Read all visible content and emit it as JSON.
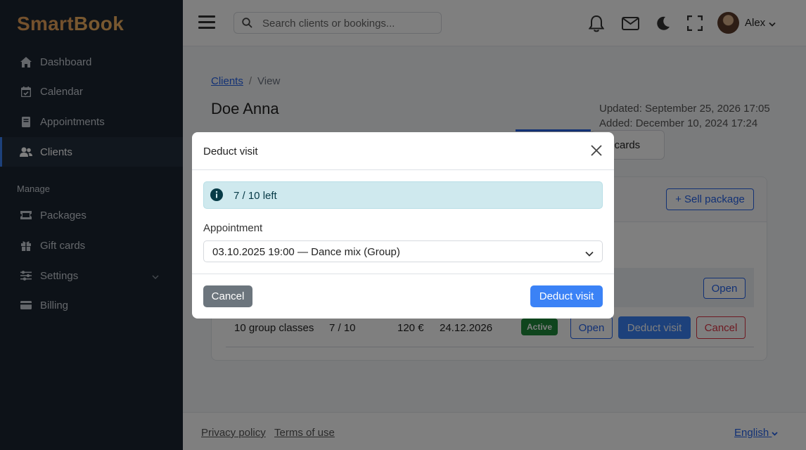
{
  "app": {
    "logo_part1": "Smart",
    "logo_part2": "Book"
  },
  "sidebar": {
    "items": [
      {
        "label": "Dashboard",
        "icon": "home-icon"
      },
      {
        "label": "Calendar",
        "icon": "calendar-check-icon"
      },
      {
        "label": "Appointments",
        "icon": "book-icon"
      },
      {
        "label": "Clients",
        "icon": "users-icon",
        "active": true
      }
    ],
    "section_label": "Manage",
    "manage_items": [
      {
        "label": "Packages",
        "icon": "ticket-icon"
      },
      {
        "label": "Gift cards",
        "icon": "gift-icon"
      },
      {
        "label": "Settings",
        "icon": "sliders-icon"
      },
      {
        "label": "Billing",
        "icon": "credit-card-icon"
      }
    ]
  },
  "header": {
    "search_placeholder": "Search clients or bookings...",
    "user_name": "Alex"
  },
  "breadcrumb": {
    "link": "Clients",
    "separator": "/",
    "current": "View"
  },
  "client": {
    "name": "Doe Anna",
    "updated": "Updated: September 25, 2026 17:05",
    "added": "Added: December 10, 2024 17:24"
  },
  "tabs": {
    "gift_cards_partial": "ft cards"
  },
  "packages_card": {
    "sell_label": "+ Sell package",
    "open_label": "Open",
    "row": {
      "name": "10 group classes",
      "visits": "7 / 10",
      "price": "120 €",
      "expires": "24.12.2026",
      "status": "Active",
      "open_label": "Open",
      "deduct_label": "Deduct visit",
      "cancel_label": "Cancel"
    }
  },
  "footer": {
    "privacy": "Privacy policy",
    "terms": "Terms of use",
    "language": "English"
  },
  "modal": {
    "title": "Deduct visit",
    "info_text": "7 / 10 left",
    "appointment_label": "Appointment",
    "appointment_value": "03.10.2025 19:00 — Dance mix (Group)",
    "cancel_label": "Cancel",
    "deduct_label": "Deduct visit"
  },
  "colors": {
    "sidebar_bg": "#1b2430",
    "accent": "#3b82f6",
    "active_badge": "#1f8a3b",
    "info_bg": "#cfe9ee",
    "danger": "#dc3545"
  }
}
